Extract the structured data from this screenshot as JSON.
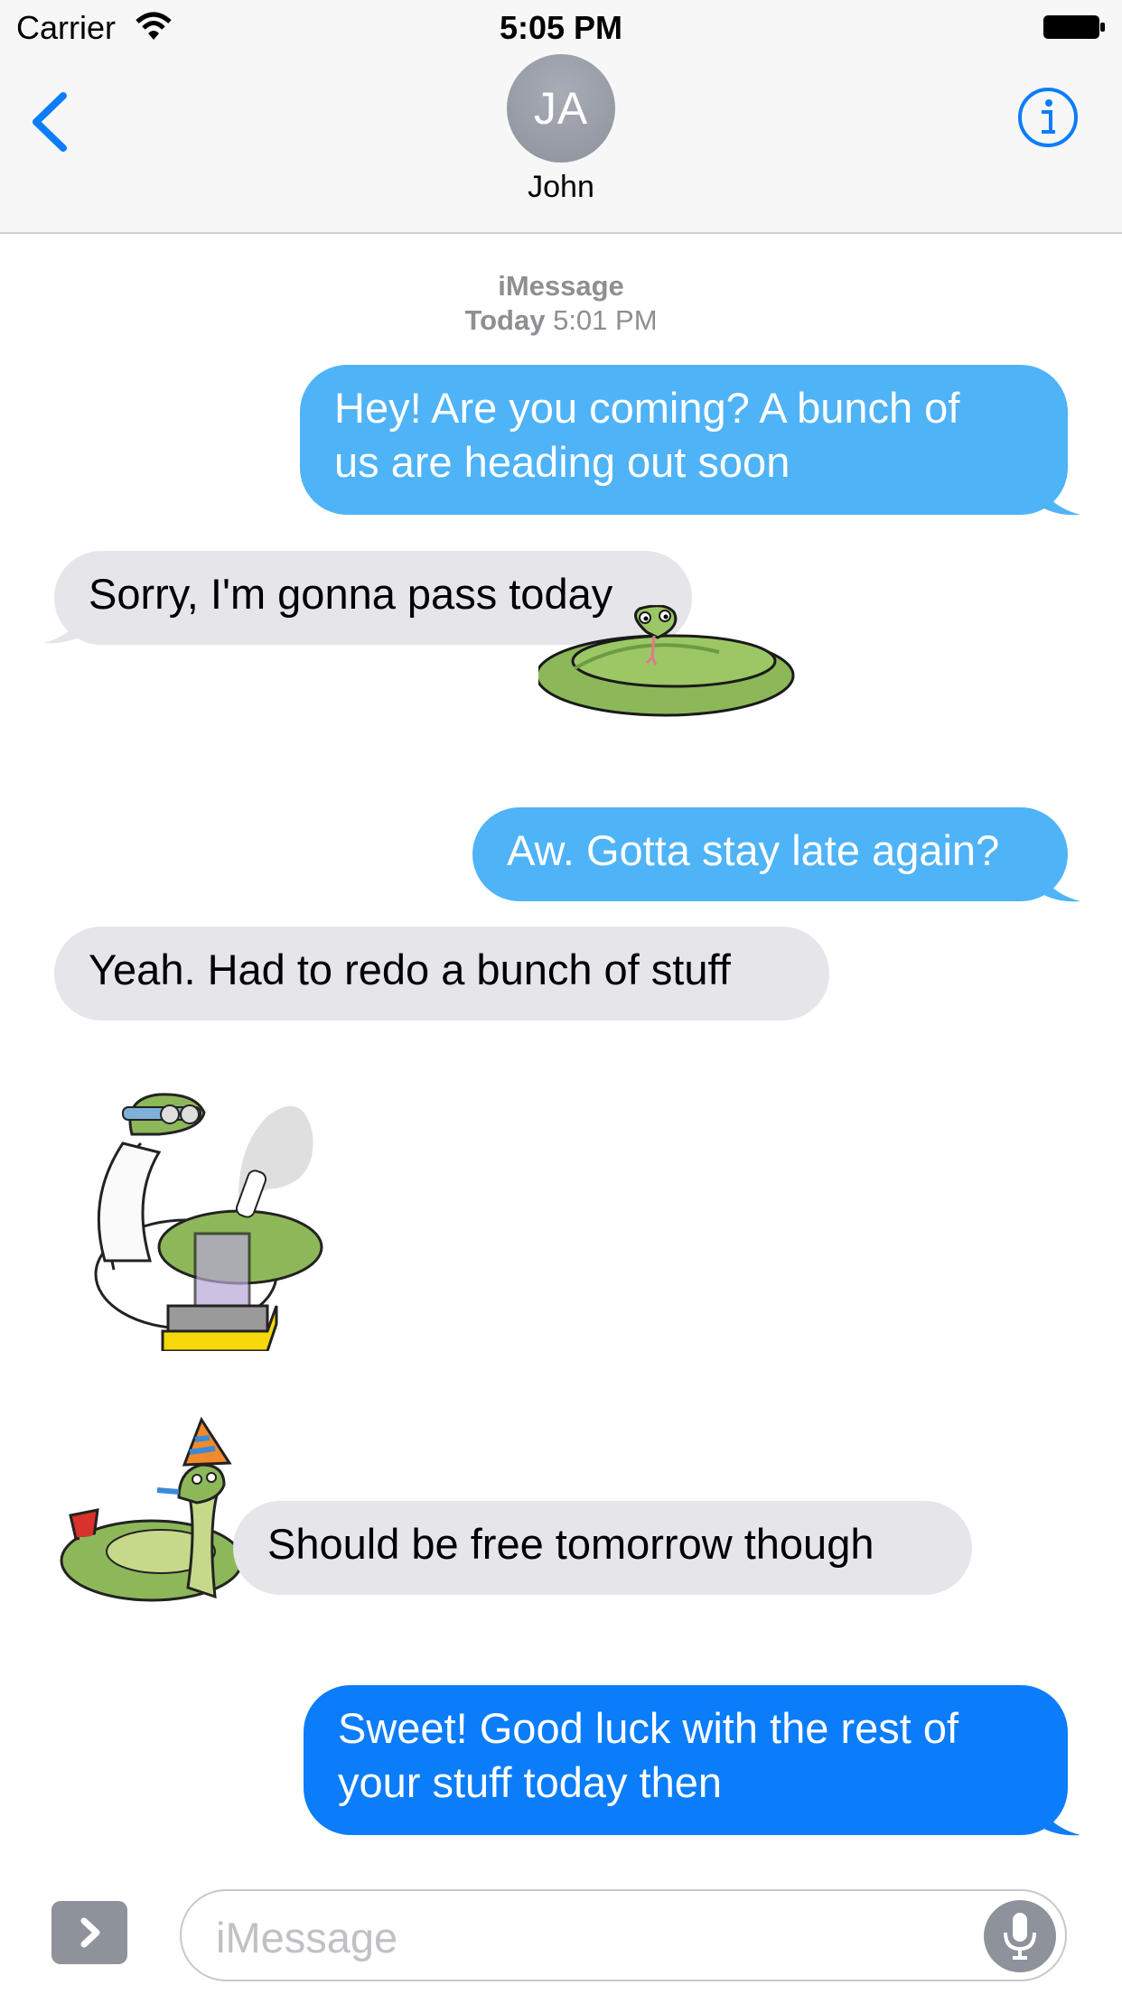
{
  "status_bar": {
    "carrier": "Carrier",
    "time": "5:05 PM"
  },
  "header": {
    "avatar_initials": "JA",
    "contact_name": "John"
  },
  "conversation": {
    "service": "iMessage",
    "day": "Today",
    "time": "5:01 PM",
    "messages": [
      {
        "direction": "outgoing",
        "line1": "Hey! Are you coming? A bunch of",
        "line2": "us are heading out soon"
      },
      {
        "direction": "incoming",
        "text": "Sorry, I'm gonna pass today"
      },
      {
        "direction": "outgoing",
        "text": "Aw. Gotta stay late again?"
      },
      {
        "direction": "incoming",
        "text": "Yeah. Had to redo a bunch of stuff"
      },
      {
        "direction": "incoming",
        "text": "Should be free tomorrow though"
      },
      {
        "direction": "outgoing",
        "line1": "Sweet! Good luck with the rest of",
        "line2": "your stuff today then"
      }
    ],
    "stickers": [
      "coiled-snake-sticker",
      "scientist-snake-sticker",
      "party-snake-sticker"
    ]
  },
  "composer": {
    "placeholder": "iMessage"
  },
  "colors": {
    "ios_blue": "#0b7dfa",
    "imessage_light_blue": "#4fb3f7",
    "incoming_gray": "#e5e5ea"
  }
}
